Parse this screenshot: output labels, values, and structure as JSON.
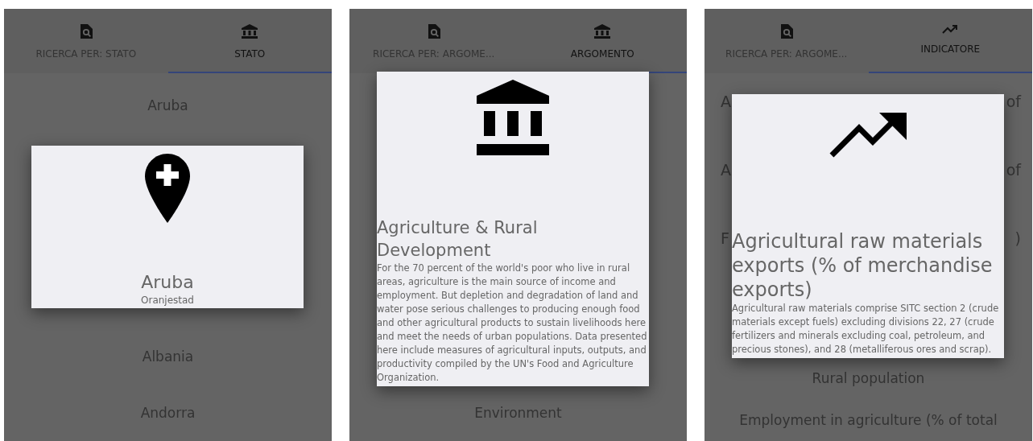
{
  "screens": [
    {
      "tabs": [
        {
          "label": "RICERCA PER: STATO",
          "kind": "search",
          "selected": false
        },
        {
          "label": "STATO",
          "kind": "bank",
          "selected": true
        }
      ],
      "list_above": [
        {
          "text": "Aruba"
        }
      ],
      "list_below": [
        {
          "text": "Albania"
        },
        {
          "text": "Andorra"
        }
      ],
      "dialog": {
        "kind": "pin",
        "title": "Aruba",
        "subtitle": "Oranjestad"
      }
    },
    {
      "tabs": [
        {
          "label": "RICERCA PER: ARGOME...",
          "kind": "search",
          "selected": false
        },
        {
          "label": "ARGOMENTO",
          "kind": "bank",
          "selected": true
        }
      ],
      "list_below": [
        {
          "text": "Environment"
        }
      ],
      "dialog": {
        "kind": "bank",
        "title": "Agriculture & Rural Development",
        "description": "For the 70 percent of the world's poor who live in rural areas, agriculture is the main source of income and employment. But depletion and degradation of land and water pose serious challenges to producing enough food and other agricultural products to sustain livelihoods here and meet the needs of urban populations. Data presented here include measures of agricultural inputs, outputs, and productivity compiled by the UN's Food and Agriculture Organization."
      }
    },
    {
      "tabs": [
        {
          "label": "RICERCA PER: ARGOME...",
          "kind": "search",
          "selected": false
        },
        {
          "label": "INDICATORE",
          "kind": "trend",
          "selected": true
        }
      ],
      "fragments": [
        {
          "left": "A",
          "right": "of"
        },
        {
          "left": "A",
          "right": "of"
        },
        {
          "left": "F",
          "right": ")"
        }
      ],
      "list_below": [
        {
          "text": "Rural population"
        },
        {
          "text": "Employment in agriculture (% of total"
        }
      ],
      "dialog": {
        "kind": "trend",
        "title": "Agricultural raw materials exports (% of merchandise exports)",
        "description": "Agricultural raw materials comprise SITC section 2 (crude materials except fuels) excluding divisions 22, 27 (crude fertilizers and minerals excluding coal, petroleum, and precious stones), and 28 (metalliferous ores and scrap)."
      }
    }
  ]
}
